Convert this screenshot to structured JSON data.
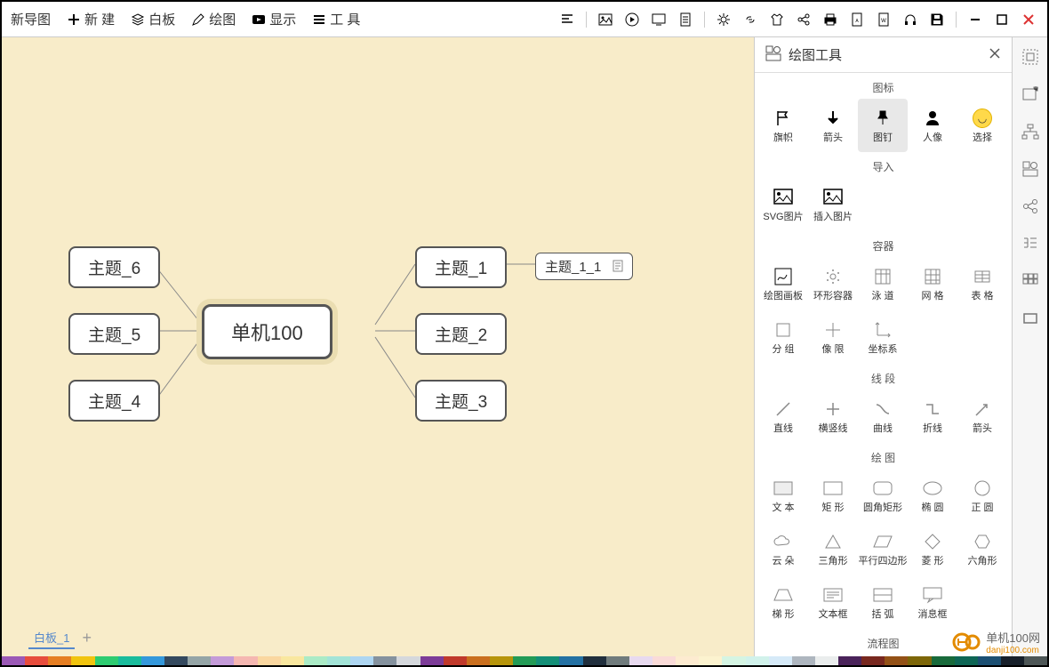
{
  "app_title": "新导图",
  "menu": {
    "new": "新 建",
    "whiteboard": "白板",
    "draw": "绘图",
    "display": "显示",
    "tools": "工 具"
  },
  "mindmap": {
    "center": "单机100",
    "nodes": {
      "t1": "主题_1",
      "t2": "主题_2",
      "t3": "主题_3",
      "t4": "主题_4",
      "t5": "主题_5",
      "t6": "主题_6",
      "t1_1": "主题_1_1"
    }
  },
  "tabs": {
    "board1": "白板_1"
  },
  "panel": {
    "title": "绘图工具",
    "sections": {
      "icons": "图标",
      "import": "导入",
      "containers": "容器",
      "lines": "线 段",
      "shapes": "绘 图",
      "flowchart": "流程图"
    },
    "tools": {
      "flag": "旗帜",
      "arrow": "箭头",
      "pin": "图钉",
      "person": "人像",
      "select": "选择",
      "svg_image": "SVG图片",
      "insert_image": "插入图片",
      "draw_canvas": "绘图画板",
      "ring_container": "环形容器",
      "swimlane": "泳 道",
      "grid": "网 格",
      "table": "表 格",
      "group": "分 组",
      "quadrant": "像 限",
      "coord": "坐标系",
      "line_straight": "直线",
      "line_hv": "横竖线",
      "line_curve": "曲线",
      "line_poly": "折线",
      "line_arrow": "箭头",
      "text": "文 本",
      "rect": "矩 形",
      "round_rect": "圆角矩形",
      "ellipse": "椭 圆",
      "circle": "正 圆",
      "cloud": "云 朵",
      "triangle": "三角形",
      "parallelogram": "平行四边形",
      "diamond": "菱 形",
      "hexagon": "六角形",
      "trapezoid": "梯 形",
      "textbox": "文本框",
      "bracket": "括 弧",
      "message": "消息框"
    }
  },
  "watermark": {
    "text": "单机100网",
    "sub": "danji100.com"
  },
  "color_strip": [
    "#9b59b6",
    "#e74c3c",
    "#e67e22",
    "#f1c40f",
    "#2ecc71",
    "#1abc9c",
    "#3498db",
    "#34495e",
    "#95a5a6",
    "#c49bd8",
    "#f5b7b1",
    "#fad7a0",
    "#f9e79f",
    "#abebc6",
    "#a3e4d7",
    "#aed6f1",
    "#85929e",
    "#d5d8dc",
    "#7d3c98",
    "#c0392b",
    "#ca6f1e",
    "#b7950b",
    "#239b56",
    "#148f77",
    "#2471a3",
    "#212f3d",
    "#707b7c",
    "#e8daef",
    "#fadbd8",
    "#fdebd0",
    "#fcf3cf",
    "#d5f5e3",
    "#d1f2eb",
    "#d6eaf8",
    "#aeb6bf",
    "#eaeded",
    "#4a235a",
    "#78281f",
    "#935116",
    "#7d6608",
    "#186a3b",
    "#0e6655",
    "#1b4f72",
    "#17202a",
    "#4d5656"
  ]
}
